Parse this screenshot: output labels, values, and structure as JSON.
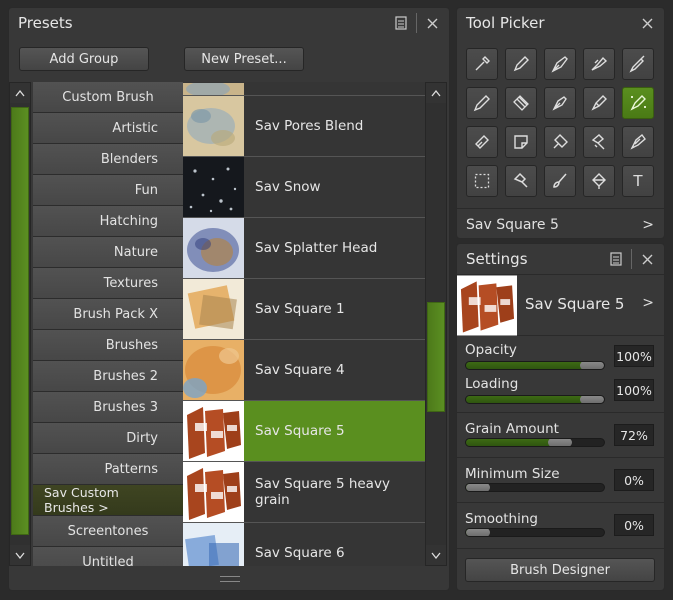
{
  "presets": {
    "title": "Presets",
    "add_group": "Add Group",
    "new_preset": "New Preset...",
    "groups": [
      "Custom Brush",
      "Artistic",
      "Blenders",
      "Fun",
      "Hatching",
      "Nature",
      "Textures",
      "Brush Pack X",
      "Brushes",
      "Brushes 2",
      "Brushes 3",
      "Dirty",
      "Patterns",
      "Sav Custom Brushes  >",
      "Screentones",
      "Untitled"
    ],
    "items": [
      "",
      "Sav Pores Blend",
      "Sav Snow",
      "Sav Splatter Head",
      "Sav Square 1",
      "Sav Square 4",
      "Sav Square 5",
      "Sav Square 5 heavy grain",
      "Sav Square 6"
    ],
    "selected_item": "Sav Square 5",
    "selected_group": "Sav Custom Brushes"
  },
  "tool_picker": {
    "title": "Tool Picker",
    "current": "Sav Square 5",
    "current_chevron": ">",
    "tools": [
      "dropper-icon",
      "pen-icon",
      "fountain-pen-icon",
      "airbrush-icon",
      "marker-icon",
      "pencil-icon",
      "roller-icon",
      "nib-icon",
      "rocket-brush-icon",
      "sparkle-brush-icon",
      "eraser-icon",
      "sticky-note-icon",
      "diamond-eraser-icon",
      "hairdryer-icon",
      "knife-icon",
      "marquee-icon",
      "hammer-icon",
      "brush-icon",
      "fill-bucket-icon",
      "text-icon"
    ],
    "text_tool_label": "T"
  },
  "settings": {
    "title": "Settings",
    "brush_name": "Sav Square 5",
    "chevron": ">",
    "opacity": {
      "label": "Opacity",
      "value": "100%",
      "level": 1.0
    },
    "loading": {
      "label": "Loading",
      "value": "100%",
      "level": 1.0
    },
    "grain": {
      "label": "Grain Amount",
      "value": "72%",
      "level": 0.72
    },
    "min_size": {
      "label": "Minimum Size",
      "value": "0%",
      "level": 0.0
    },
    "smoothing": {
      "label": "Smoothing",
      "value": "0%",
      "level": 0.0
    },
    "brush_designer": "Brush Designer"
  },
  "colors": {
    "accent": "#5a8f1f",
    "panel": "#383838",
    "background": "#2b2b2b"
  }
}
